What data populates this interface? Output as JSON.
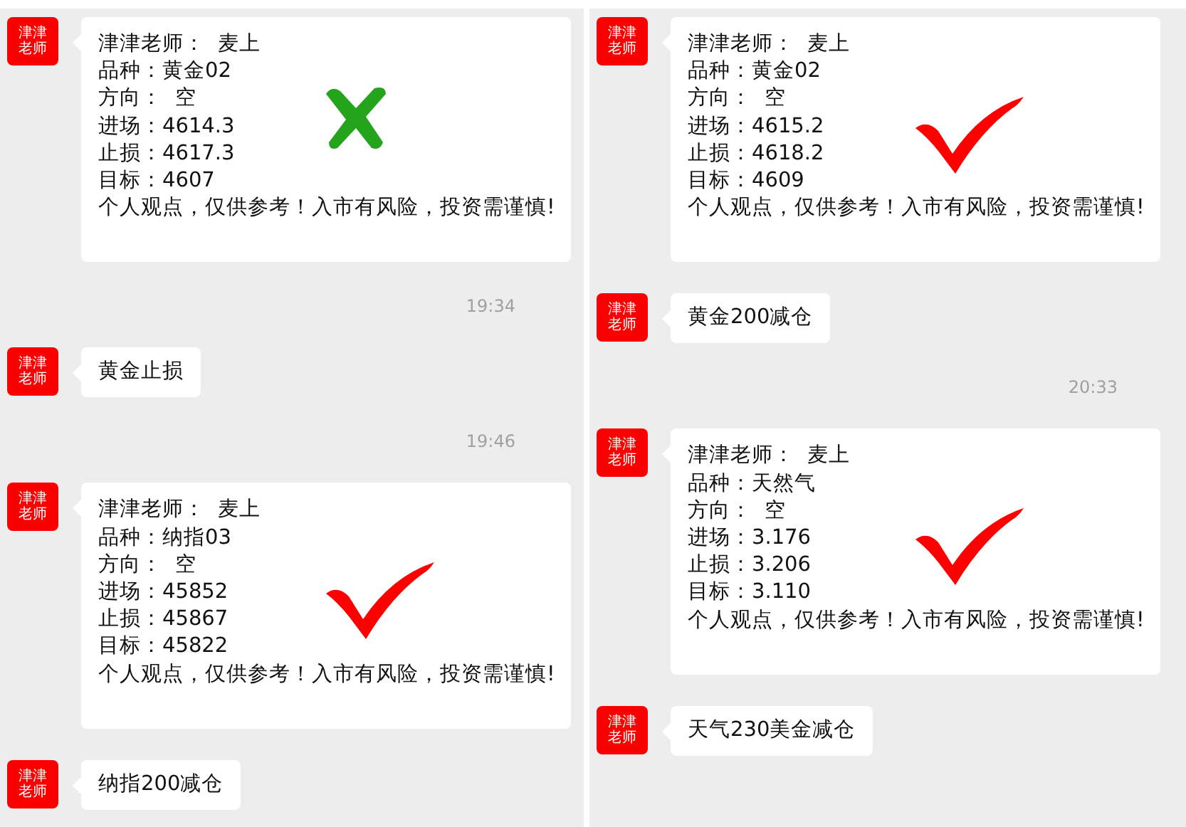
{
  "columns": [
    {
      "items": [
        {
          "kind": "signal",
          "avatar": "津津老师",
          "lines": [
            "津津老师：  麦上",
            "品种：黄金02",
            "方向：  空",
            "进场：4614.3",
            "止损：4617.3",
            "目标：4607",
            "个人观点，仅供参考！入市有风险，投资需谨慎!"
          ],
          "correct": false
        },
        {
          "kind": "time",
          "text": "19:34"
        },
        {
          "kind": "text",
          "avatar": "津津老师",
          "text": "黄金止损"
        },
        {
          "kind": "time",
          "text": "19:46"
        },
        {
          "kind": "signal",
          "avatar": "津津老师",
          "lines": [
            "津津老师：  麦上",
            "品种：纳指03",
            "方向：  空",
            "进场：45852",
            "止损：45867",
            "目标：45822",
            "个人观点，仅供参考！入市有风险，投资需谨慎!"
          ],
          "correct": true
        },
        {
          "kind": "text",
          "avatar": "津津老师",
          "text": "纳指200减仓"
        }
      ]
    },
    {
      "items": [
        {
          "kind": "signal",
          "avatar": "津津老师",
          "lines": [
            "津津老师：  麦上",
            "品种：黄金02",
            "方向：  空",
            "进场：4615.2",
            "止损：4618.2",
            "目标：4609",
            "个人观点，仅供参考！入市有风险，投资需谨慎!"
          ],
          "correct": true
        },
        {
          "kind": "text",
          "avatar": "津津老师",
          "text": "黄金200减仓"
        },
        {
          "kind": "time",
          "text": "20:33"
        },
        {
          "kind": "signal",
          "avatar": "津津老师",
          "lines": [
            "津津老师：  麦上",
            "品种：天然气",
            "方向：  空",
            "进场：3.176",
            "止损：3.206",
            "目标：3.110",
            "个人观点，仅供参考！入市有风险，投资需谨慎!"
          ],
          "correct": true
        },
        {
          "kind": "text",
          "avatar": "津津老师",
          "text": "天气230美金减仓"
        }
      ]
    }
  ]
}
